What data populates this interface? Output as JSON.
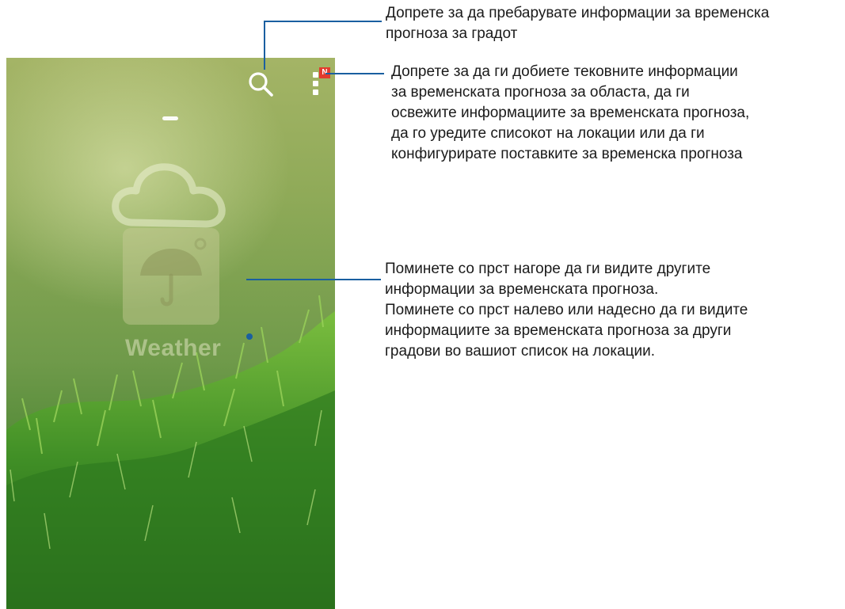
{
  "app": {
    "search_label": "search-icon",
    "menu_label": "more-options-icon",
    "badge": "N",
    "app_name": "Weather"
  },
  "callouts": {
    "search": {
      "lines": [
        "Допрете за да пребарувате информации за временска",
        "прогноза за градот"
      ]
    },
    "menu": {
      "lines": [
        "Допрете за да ги добиете тековните информации",
        "за временската прогноза за областа, да ги",
        "освежите информациите за временската прогноза,",
        "да го уредите списокот на локации или да ги",
        "конфигурирате поставките за временска прогноза"
      ]
    },
    "swipe": {
      "lines": [
        "Поминете со прст нагоре да ги видите другите",
        "информации за временската прогноза.",
        "Поминете со прст налево или надесно да ги видите",
        "информациите за временската прогноза за други",
        "градови во вашиот список на локации."
      ]
    }
  },
  "colors": {
    "callout_line": "#1a5fa0",
    "badge": "#e23b2d"
  }
}
